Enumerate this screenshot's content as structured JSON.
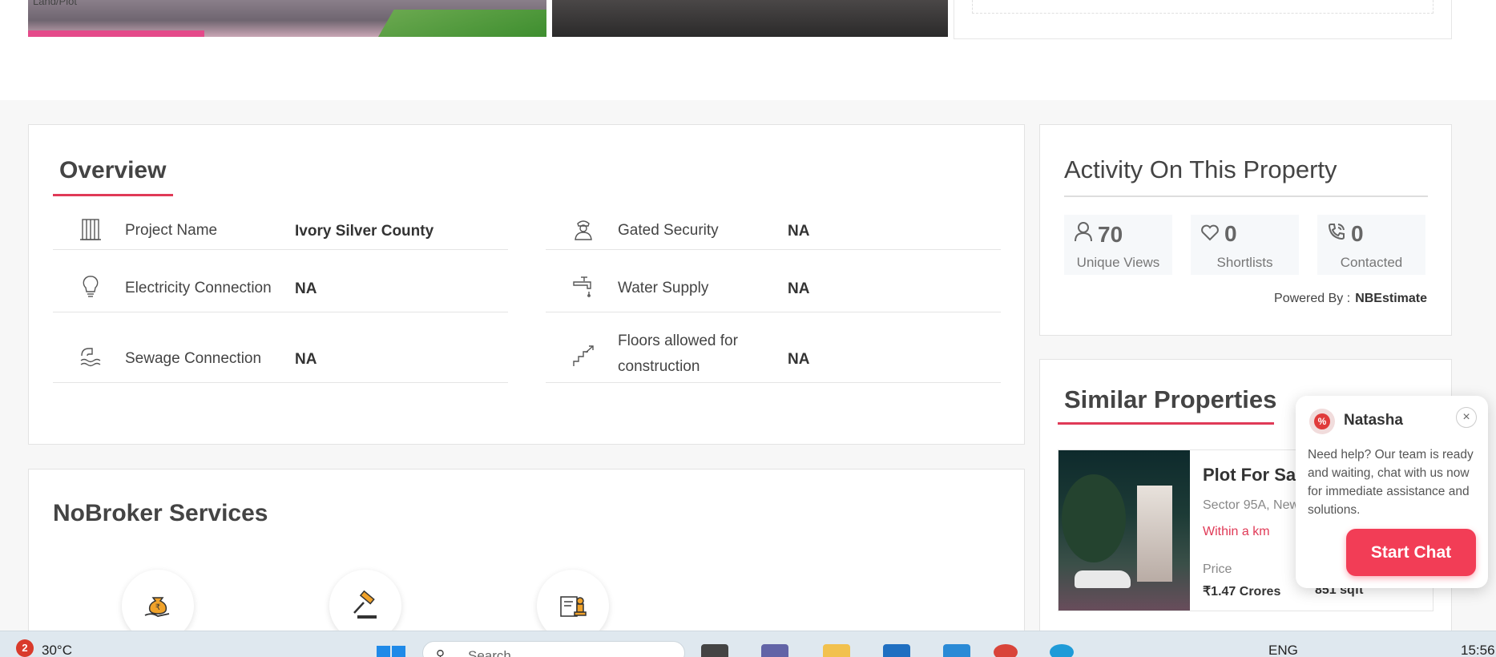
{
  "top": {
    "image1_tag": "Land/Plot"
  },
  "overview": {
    "title": "Overview",
    "rows": [
      {
        "label": "Project Name",
        "value": "Ivory Silver County",
        "icon": "building-icon"
      },
      {
        "label": "Gated Security",
        "value": "NA",
        "icon": "security-guard-icon"
      },
      {
        "label": "Electricity Connection",
        "value": "NA",
        "icon": "bulb-icon"
      },
      {
        "label": "Water Supply",
        "value": "NA",
        "icon": "water-tap-icon"
      },
      {
        "label": "Sewage Connection",
        "value": "NA",
        "icon": "sewage-icon"
      },
      {
        "label": "Floors allowed for construction",
        "value": "NA",
        "icon": "stairs-icon"
      }
    ]
  },
  "services": {
    "title": "NoBroker Services",
    "items": [
      "money-bag-icon",
      "legal-gavel-icon",
      "rent-agreement-stamp-icon"
    ]
  },
  "activity": {
    "title": "Activity On This Property",
    "stats": [
      {
        "value": "70",
        "label": "Unique Views",
        "icon": "user-icon"
      },
      {
        "value": "0",
        "label": "Shortlists",
        "icon": "heart-icon"
      },
      {
        "value": "0",
        "label": "Contacted",
        "icon": "phone-icon"
      }
    ],
    "powered_label": "Powered By :",
    "powered_brand": "NBEstimate"
  },
  "similar": {
    "title": "Similar Properties",
    "item": {
      "name": "Plot For Sal",
      "location": "Sector 95A, New",
      "distance": "Within a km",
      "price_label": "Price",
      "price": "₹1.47 Crores",
      "area": "851 sqft"
    }
  },
  "chat": {
    "agent_name": "Natasha",
    "message": "Need help? Our team is ready and waiting, chat with us now for immediate assistance and solutions.",
    "button": "Start Chat",
    "close": "×"
  },
  "taskbar": {
    "badge": "2",
    "temperature": "30°C",
    "search_placeholder": "Search",
    "language": "ENG",
    "time": "15:56"
  },
  "colors": {
    "accent": "#e03a57",
    "chat_button": "#f23d56"
  }
}
